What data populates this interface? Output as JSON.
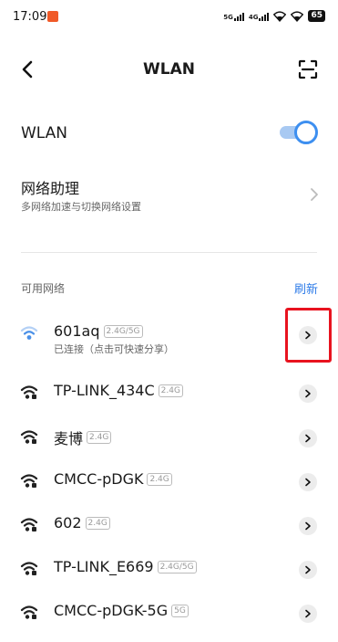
{
  "status_bar": {
    "time": "17:09",
    "net1": "5G",
    "net2": "4G",
    "battery": "65"
  },
  "header": {
    "title": "WLAN"
  },
  "wlan": {
    "label": "WLAN",
    "enabled": true
  },
  "assistant": {
    "title": "网络助理",
    "subtitle": "多网络加速与切换网络设置"
  },
  "available": {
    "section_label": "可用网络",
    "refresh_label": "刷新"
  },
  "networks": [
    {
      "name": "601aq",
      "band": "2.4G/5G",
      "status": "已连接（点击可快速分享）",
      "connected": true
    },
    {
      "name": "TP-LINK_434C",
      "band": "2.4G"
    },
    {
      "name": "麦博",
      "band": "2.4G"
    },
    {
      "name": "CMCC-pDGK",
      "band": "2.4G"
    },
    {
      "name": "602",
      "band": "2.4G"
    },
    {
      "name": "TP-LINK_E669",
      "band": "2.4G/5G"
    },
    {
      "name": "CMCC-pDGK-5G",
      "band": "5G"
    }
  ],
  "colors": {
    "accent": "#3d8ff0",
    "highlight": "#e8131f"
  }
}
